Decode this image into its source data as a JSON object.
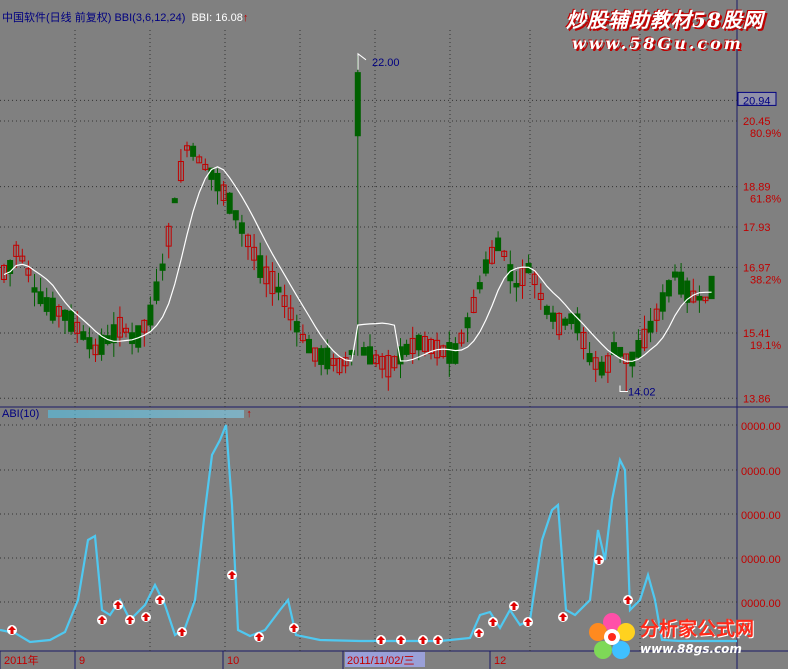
{
  "header": {
    "stock_name": "中国软件(日线 前复权)",
    "indicator": "BBI(3,6,12,24)",
    "bbi_label": "BBI: 16.08",
    "arrow": "↑"
  },
  "lower_header": {
    "name": "ABI(10)",
    "arrow": "↑"
  },
  "watermark": {
    "line1": "炒股辅助教材58股网",
    "line2": "www.58Gu.com"
  },
  "logo": {
    "title": "分析家公式网",
    "url": "www.88gs.com",
    "flower_icon": "flower-icon"
  },
  "colors": {
    "up_candle": "#c00000",
    "down_candle": "#006000",
    "bbi_line": "#ffffff",
    "abi_line": "#4fc8f0",
    "axis_text_red": "#c00000",
    "header_blue": "#000080",
    "grid": "#333333",
    "up_arrow_fill": "#e00000"
  },
  "chart_data": [
    {
      "type": "candlestick",
      "title": "中国软件(日线 前复权)",
      "series": [
        {
          "name": "BBI(3,6,12,24)",
          "last_value": 16.08
        }
      ],
      "y_ticks": [
        {
          "value": 20.94,
          "label": "20.94",
          "boxed": true
        },
        {
          "value": 20.45,
          "label": "20.45",
          "pct": "80.9%"
        },
        {
          "value": 18.89,
          "label": "18.89",
          "pct": "61.8%"
        },
        {
          "value": 17.93,
          "label": "17.93",
          "pct": ""
        },
        {
          "value": 16.97,
          "label": "16.97",
          "pct": "38.2%"
        },
        {
          "value": 15.41,
          "label": "15.41",
          "pct": "19.1%"
        },
        {
          "value": 13.86,
          "label": "13.86",
          "pct": ""
        }
      ],
      "ylim": [
        13.7,
        21.9
      ],
      "annotations": [
        {
          "label": "22.00",
          "value": 22.0,
          "kind": "max"
        },
        {
          "label": "14.02",
          "value": 14.02,
          "kind": "min"
        }
      ],
      "grid": true
    },
    {
      "type": "line",
      "title": "ABI(10)",
      "y_ticks": [
        "0000.00",
        "0000.00",
        "0000.00",
        "0000.00",
        "0000.00"
      ],
      "x_labels": [
        "2011年",
        "9",
        "10",
        "2011/11/02/三",
        "12"
      ],
      "markers": "up-arrow",
      "grid": true
    }
  ]
}
